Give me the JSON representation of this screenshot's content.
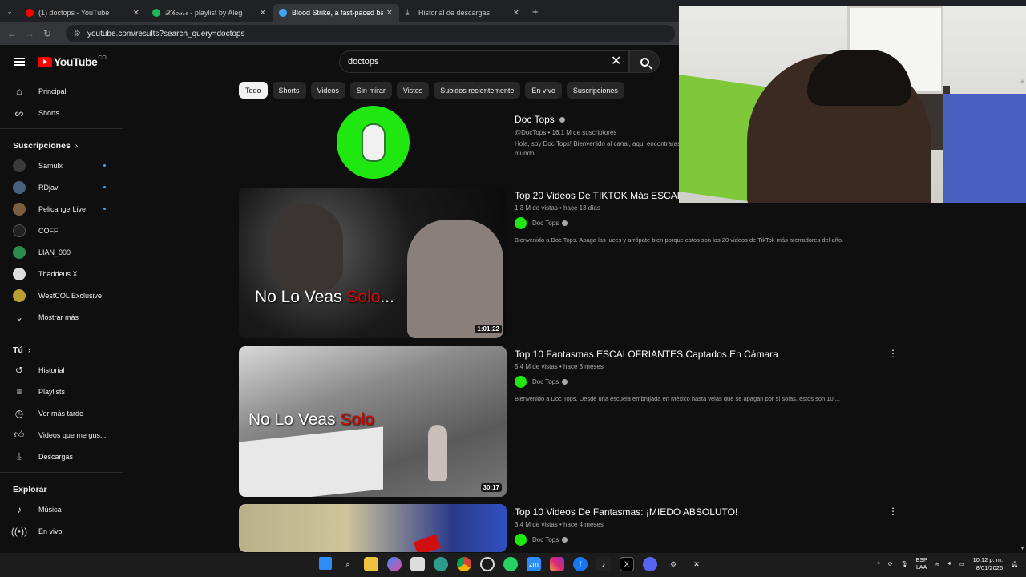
{
  "browser": {
    "tabs": [
      {
        "title": "(1) doctops - YouTube",
        "color": "#ff0000",
        "active": false
      },
      {
        "title": "𝒳𝒽𝑜𝓊𝓈𝑒 - playlist by Aleg",
        "color": "#1db954",
        "active": false
      },
      {
        "title": "Blood Strike, a fast-paced battl",
        "color": "#3ea6ff",
        "active": true
      },
      {
        "title": "Historial de descargas",
        "color": "#aaaaaa",
        "active": false
      }
    ],
    "url": "youtube.com/results?search_query=doctops"
  },
  "youtube": {
    "logo_text": "YouTube",
    "country": "CO",
    "search_value": "doctops"
  },
  "sidebar": {
    "main": [
      {
        "label": "Principal",
        "icon": "home-icon"
      },
      {
        "label": "Shorts",
        "icon": "shorts-icon"
      }
    ],
    "subs_heading": "Suscripciones",
    "subscriptions": [
      {
        "label": "Samulx",
        "color": "#3a3a3a",
        "dot": true
      },
      {
        "label": "RDjavi",
        "color": "#4a6080",
        "dot": true
      },
      {
        "label": "PelicangerLive",
        "color": "#7a6040",
        "dot": true
      },
      {
        "label": "COFF",
        "color": "#222222",
        "dot": false
      },
      {
        "label": "LIAN_000",
        "color": "#2d8a4a",
        "dot": false
      },
      {
        "label": "Thaddeus X",
        "color": "#dddddd",
        "dot": false
      },
      {
        "label": "WestCOL Exclusive",
        "color": "#b8a030",
        "dot": false
      }
    ],
    "show_more": "Mostrar más",
    "you_heading": "Tú",
    "you": [
      {
        "label": "Historial",
        "icon": "history-icon"
      },
      {
        "label": "Playlists",
        "icon": "playlists-icon"
      },
      {
        "label": "Ver más tarde",
        "icon": "watch-later-icon"
      },
      {
        "label": "Videos que me gus...",
        "icon": "liked-icon"
      },
      {
        "label": "Descargas",
        "icon": "downloads-icon"
      }
    ],
    "explore_heading": "Explorar",
    "explore": [
      {
        "label": "Música",
        "icon": "music-icon"
      },
      {
        "label": "En vivo",
        "icon": "live-icon"
      }
    ]
  },
  "chips": [
    "Todo",
    "Shorts",
    "Videos",
    "Sin mirar",
    "Vistos",
    "Subidos recientemente",
    "En vivo",
    "Suscripciones"
  ],
  "channel": {
    "name": "Doc Tops",
    "handle_subs": "@DocTops • 16.1 M de suscriptores",
    "desc_line1": "Hola, soy Doc Tops! Bienvenido al canal, aquí encontraras",
    "desc_line2": "mundo ..."
  },
  "videos": [
    {
      "title": "Top 20 Videos De TIKTOK Más ESCALOF",
      "meta": "1.3 M de vistas • hace 13 días",
      "channel": "Doc Tops",
      "desc": "Bienvenido a Doc Tops. Apaga las luces y arrópate bien porque estos son los 20 videos de TikTok más aterradores del año.",
      "thumb_text_a": "No Lo Veas ",
      "thumb_text_b": "Solo",
      "thumb_text_c": "...",
      "duration": "1:01:22"
    },
    {
      "title": "Top 10 Fantasmas ESCALOFRIANTES Captados En Cámara",
      "meta": "5.4 M de vistas • hace 3 meses",
      "channel": "Doc Tops",
      "desc": "Bienvenido a Doc Tops. Desde una escuela embrujada en México hasta velas que se apagan por sí solas, estos son 10 ...",
      "thumb_text_a": "No Lo Veas ",
      "thumb_text_b": "Solo",
      "thumb_text_c": "",
      "duration": "30:17"
    },
    {
      "title": "Top 10 Videos De Fantasmas: ¡MIEDO ABSOLUTO!",
      "meta": "3.4 M de vistas • hace 4 meses",
      "channel": "Doc Tops",
      "desc": "",
      "thumb_text_a": "",
      "thumb_text_b": "",
      "thumb_text_c": "",
      "duration": ""
    }
  ],
  "taskbar": {
    "lang1": "ESP",
    "lang2": "LAA",
    "time": "10:12 p. m.",
    "date": "8/01/2026"
  }
}
